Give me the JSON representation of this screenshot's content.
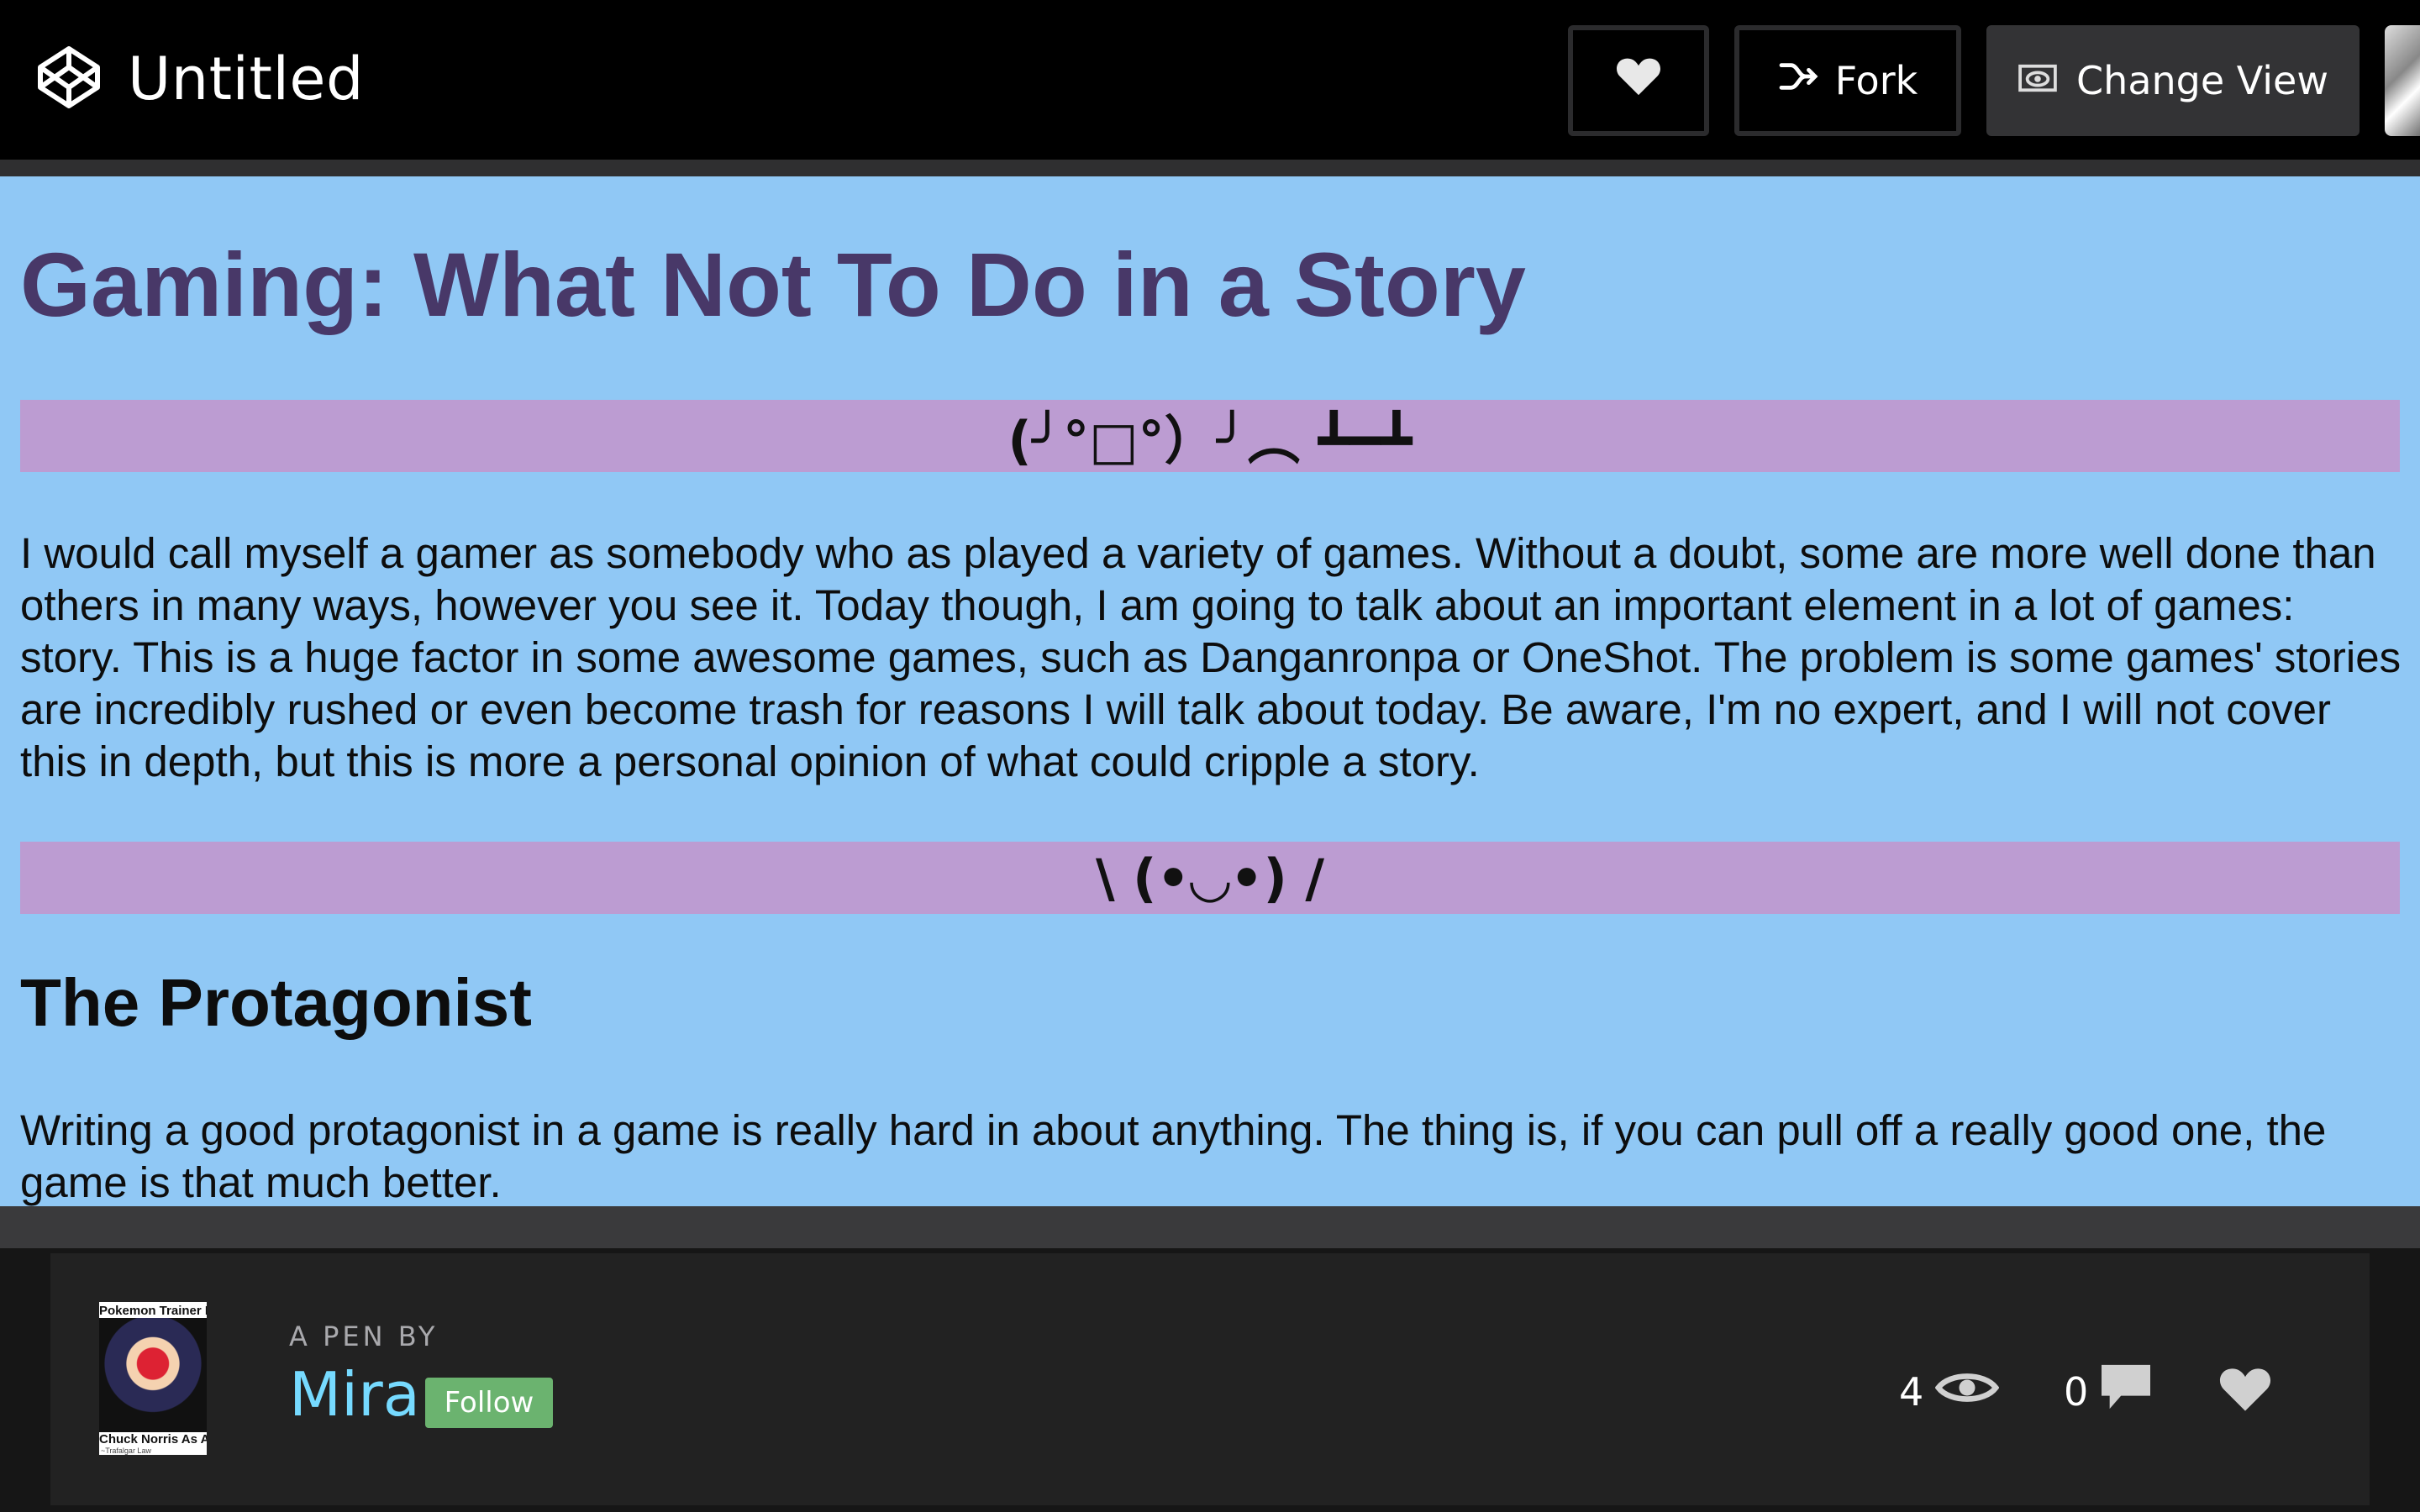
{
  "header": {
    "title": "Untitled",
    "logo_icon": "codepen-logo-icon",
    "actions": {
      "heart_icon": "heart-icon",
      "fork_label": "Fork",
      "change_view_label": "Change View"
    }
  },
  "article": {
    "title": "Gaming: What Not To Do in a Story",
    "banner_1": "(╯°□°）╯︵ ┻━┻",
    "intro": "I would call myself a gamer as somebody who as played a variety of games. Without a doubt, some are more well done than others in many ways, however you see it. Today though, I am going to talk about an important element in a lot of games: story. This is a huge factor in some awesome games, such as Danganronpa or OneShot. The problem is some games' stories are incredibly rushed or even become trash for reasons I will talk about today. Be aware, I'm no expert, and I will not cover this in depth, but this is more a personal opinion of what could cripple a story.",
    "banner_2": "\\ (•◡•) /",
    "section_heading": "The Protagonist",
    "section_text": "Writing a good protagonist in a game is really hard in about anything. The thing is, if you can pull off a really good one, the game is that much better."
  },
  "footer": {
    "pen_by_label": "A PEN BY",
    "author": "Mira",
    "follow_label": "Follow",
    "views_count": "4",
    "comments_count": "0",
    "avatar_text_top": "Pokemon Trainer Red",
    "avatar_text_bottom": "Chuck Norris As A Kid",
    "avatar_text_small": "~Trafalgar Law"
  },
  "colors": {
    "content_bg": "#90c8f5",
    "title": "#483868",
    "banner_bg": "#bc9cd2",
    "author_link": "#76daff",
    "follow_bg": "#6bb36f"
  }
}
